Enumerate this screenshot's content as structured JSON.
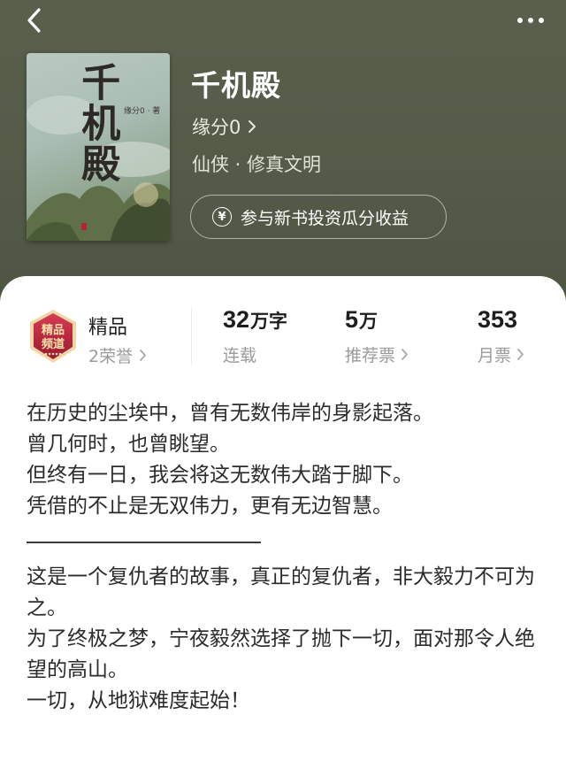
{
  "topbar": {
    "back_icon": "chevron-left-icon",
    "more_icon": "more-dots-icon"
  },
  "book": {
    "cover_title": "千机殿",
    "cover_author": "缘分0 · 著",
    "title": "千机殿",
    "author": "缘分0",
    "genre": "仙侠 · 修真文明",
    "invest_label": "参与新书投资瓜分收益",
    "invest_icon": "yen-coin-icon"
  },
  "stats": {
    "quality_label": "精品",
    "honor_label": "2荣誉",
    "badge_text_1": "精品",
    "badge_text_2": "频道",
    "word_count_num": "32",
    "word_count_unit": "万字",
    "status_label": "连载",
    "recommend_num": "5",
    "recommend_unit": "万",
    "recommend_label": "推荐票",
    "monthly_num": "353",
    "monthly_label": "月票"
  },
  "description": {
    "lines_1": [
      "在历史的尘埃中，曾有无数伟岸的身影起落。",
      "曾几何时，也曾眺望。",
      "但终有一日，我会将这无数伟大踏于脚下。",
      "凭借的不止是无双伟力，更有无边智慧。"
    ],
    "lines_2": [
      "这是一个复仇者的故事，真正的复仇者，非大毅力不可为之。",
      "为了终极之梦，宁夜毅然选择了抛下一切，面对那令人绝望的高山。",
      "一切，从地狱难度起始！"
    ]
  },
  "colors": {
    "header_bg": "#545b48",
    "badge_red": "#b3213a",
    "text_gray": "#9a9a9a"
  }
}
